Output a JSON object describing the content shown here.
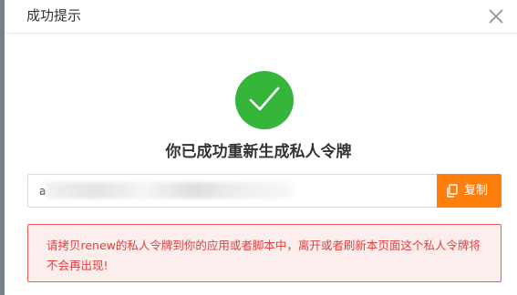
{
  "dialog": {
    "title": "成功提示",
    "close_icon": "close-icon"
  },
  "success": {
    "icon": "check-circle-icon",
    "color": "#35b53a",
    "headline": "你已成功重新生成私人令牌"
  },
  "token": {
    "value": "a"
  },
  "copy_button": {
    "label": "复制",
    "icon": "copy-icon",
    "color": "#ff7f0e"
  },
  "alert": {
    "message": "请拷贝renew的私人令牌到你的应用或者脚本中，离开或者刷新本页面这个私人令牌将不会再出现!"
  }
}
